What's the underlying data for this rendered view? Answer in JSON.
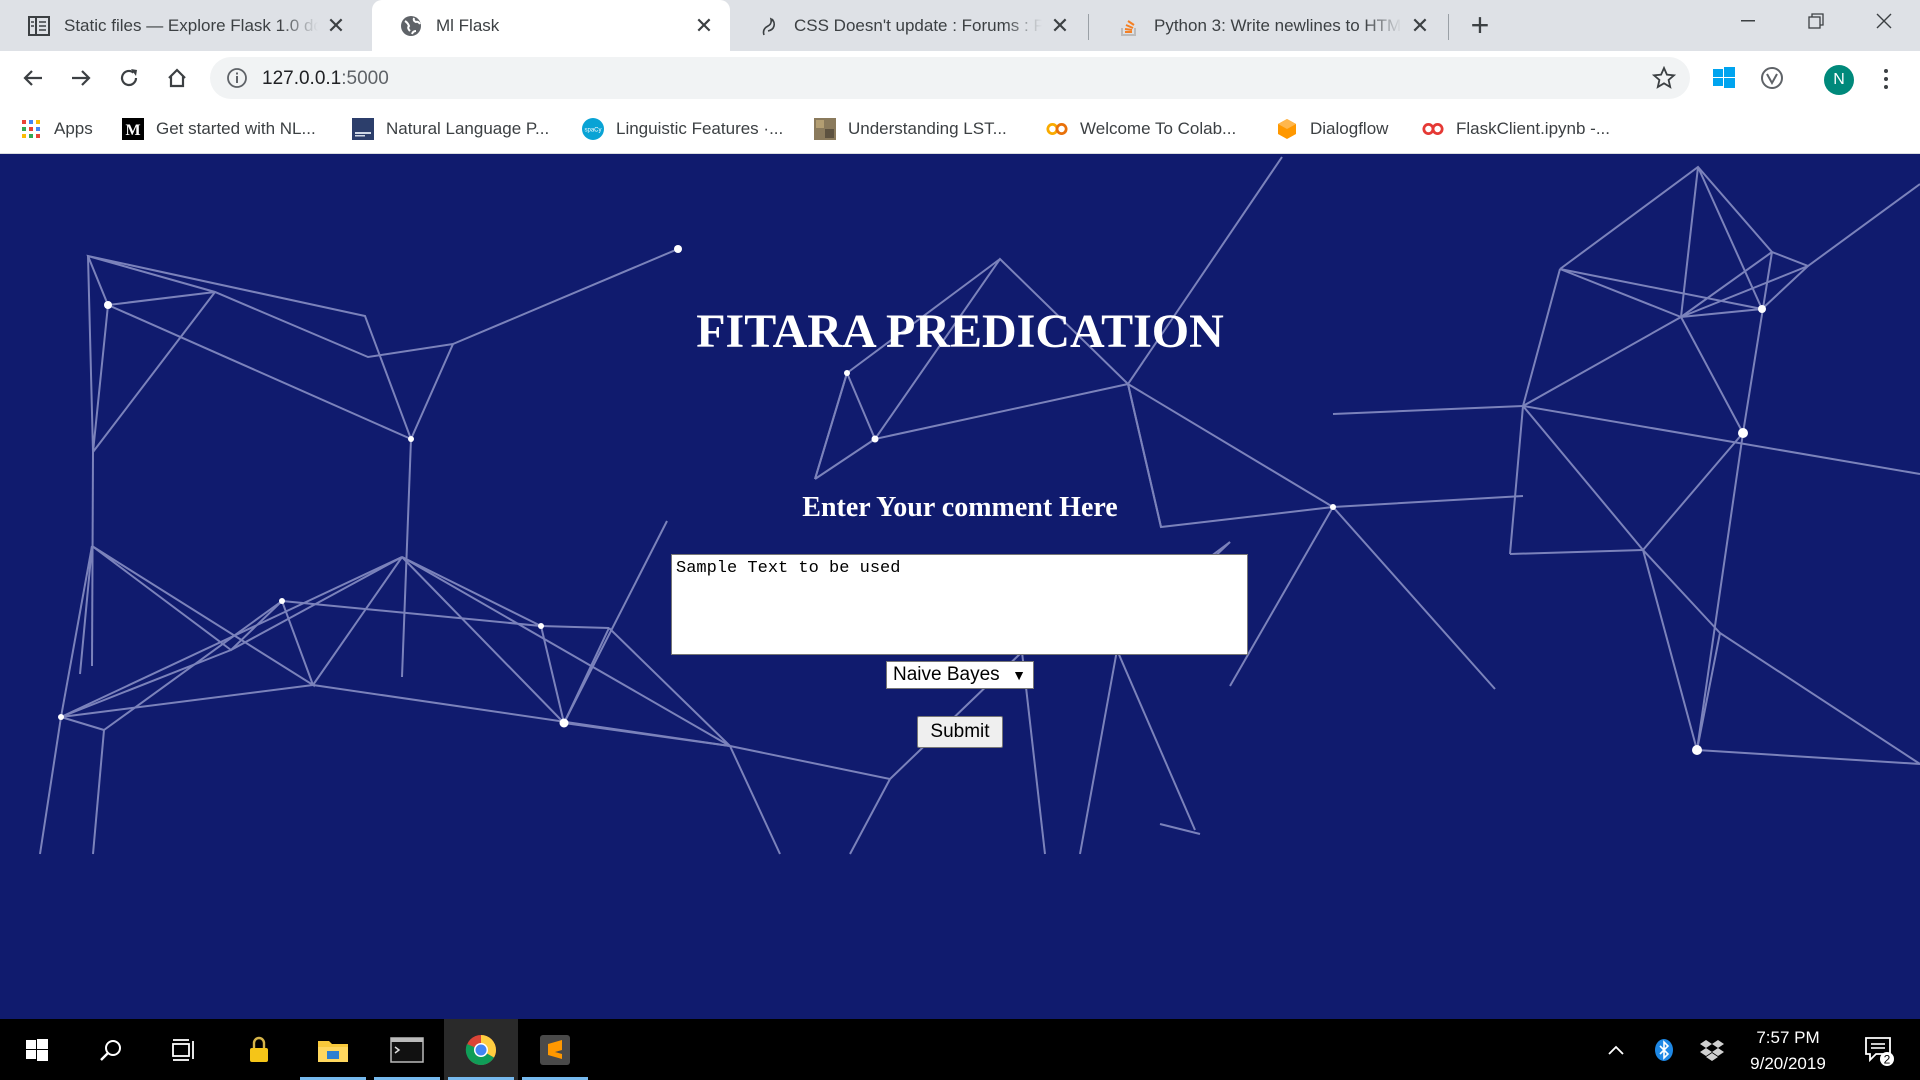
{
  "browser": {
    "tabs": [
      {
        "title": "Static files — Explore Flask 1.0 documentation",
        "icon": "book-icon",
        "active": false
      },
      {
        "title": "Ml Flask",
        "icon": "globe-icon",
        "active": true
      },
      {
        "title": "CSS Doesn't update : Forums : PythonAnywhere",
        "icon": "python-anywhere-icon",
        "active": false
      },
      {
        "title": "Python 3: Write newlines to HTML - Stack Overflow",
        "icon": "stackoverflow-icon",
        "active": false
      }
    ],
    "url_host": "127.0.0.1",
    "url_port": ":5000",
    "profile_initial": "N",
    "bookmarks": [
      {
        "label": "Apps",
        "icon": "apps-grid-icon"
      },
      {
        "label": "Get started with NL...",
        "icon": "medium-icon"
      },
      {
        "label": "Natural Language P...",
        "icon": "book-cover-icon"
      },
      {
        "label": "Linguistic Features ·...",
        "icon": "spacy-icon"
      },
      {
        "label": "Understanding LST...",
        "icon": "image-thumb-icon"
      },
      {
        "label": "Welcome To Colab...",
        "icon": "colab-icon"
      },
      {
        "label": "Dialogflow",
        "icon": "dialogflow-icon"
      },
      {
        "label": "FlaskClient.ipynb -...",
        "icon": "colab-icon"
      }
    ]
  },
  "page": {
    "title": "FITARA PREDICATION",
    "comment_label": "Enter Your comment Here",
    "comment_value": "Sample Text to be used",
    "model_selected": "Naive Bayes",
    "submit_label": "Submit",
    "background_color": "#101b6e"
  },
  "taskbar": {
    "apps": [
      "windows-start-icon",
      "search-icon",
      "task-view-icon",
      "lock-app-icon",
      "file-explorer-icon",
      "terminal-icon",
      "chrome-icon",
      "sublime-text-icon"
    ],
    "time": "7:57 PM",
    "date": "9/20/2019",
    "notification_count": "2"
  }
}
